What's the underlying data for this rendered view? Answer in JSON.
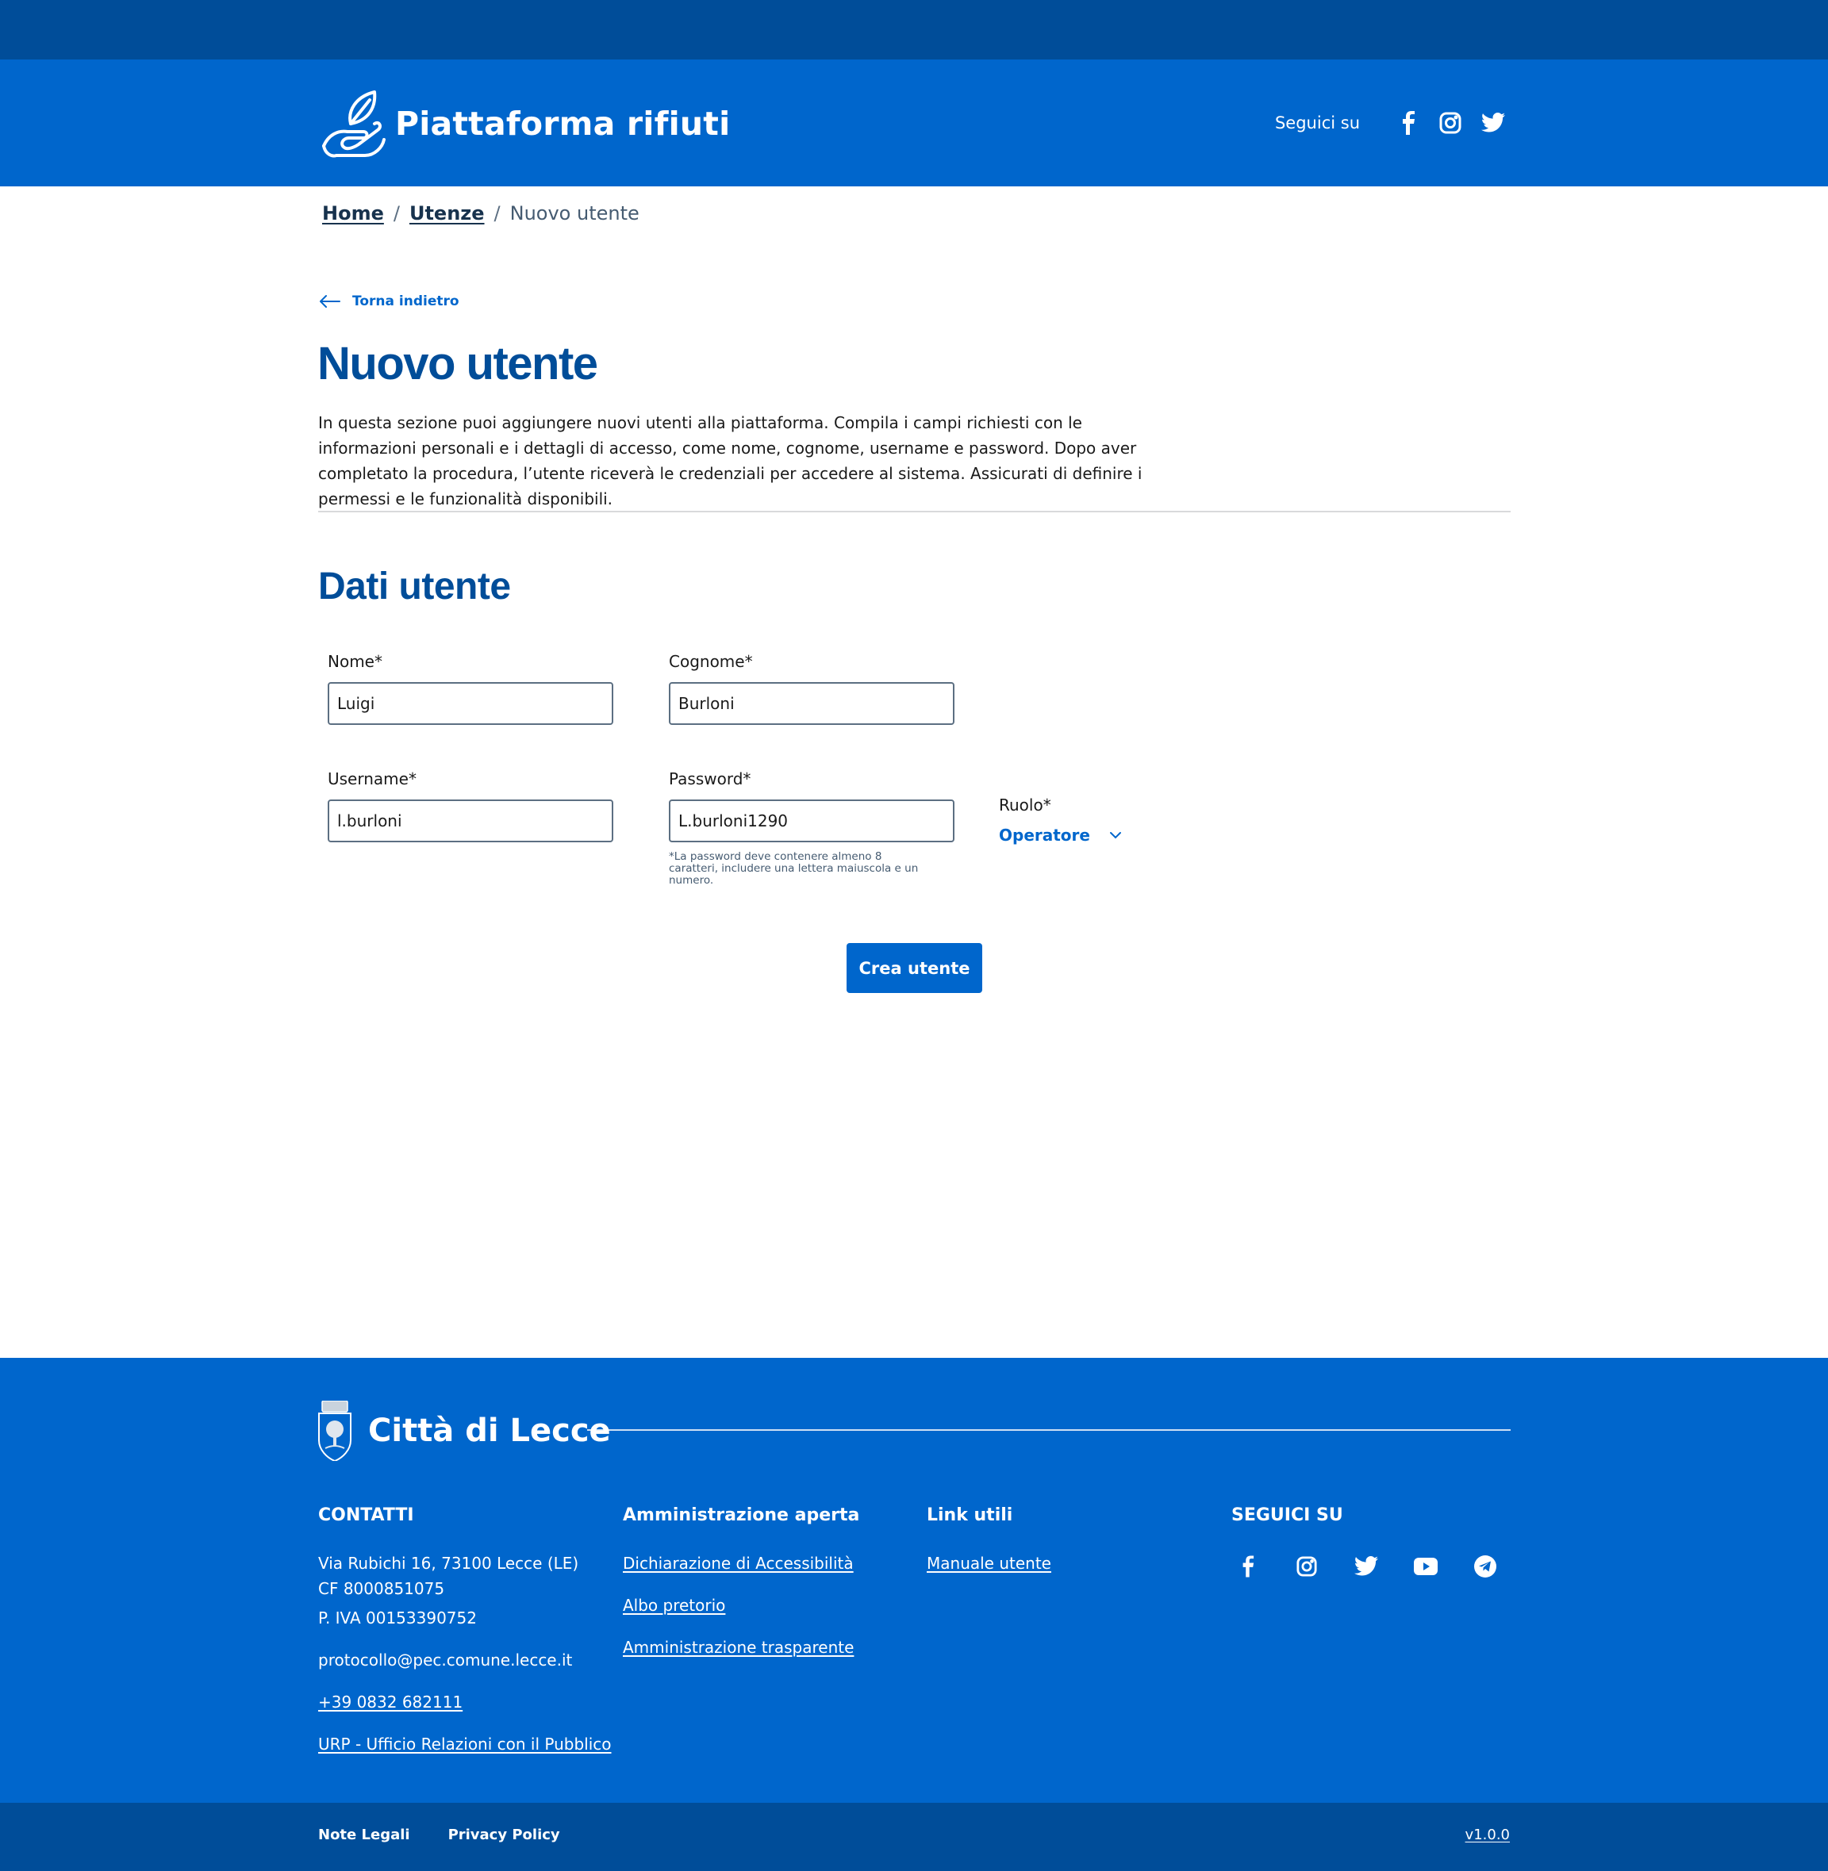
{
  "header": {
    "title": "Piattaforma rifiuti",
    "follow_label": "Seguici su",
    "social": [
      "facebook-icon",
      "instagram-icon",
      "twitter-icon"
    ]
  },
  "breadcrumb": {
    "home": "Home",
    "users": "Utenze",
    "current": "Nuovo utente",
    "separator": "/"
  },
  "back_label": "Torna indietro",
  "page": {
    "title": "Nuovo utente",
    "intro": "In questa sezione puoi aggiungere nuovi utenti alla piattaforma. Compila i campi richiesti con le informazioni personali e i dettagli di accesso, come nome, cognome, username e password. Dopo aver completato la procedura, l’utente riceverà le credenziali per accedere al sistema. Assicurati di definire i permessi e le funzionalità disponibili."
  },
  "form": {
    "section_title": "Dati utente",
    "nome": {
      "label": "Nome*",
      "value": "Luigi"
    },
    "cognome": {
      "label": "Cognome*",
      "value": "Burloni"
    },
    "username": {
      "label": "Username*",
      "value": "l.burloni"
    },
    "password": {
      "label": "Password*",
      "value": "L.burloni1290",
      "help": "*La password deve contenere almeno 8 caratteri, includere una lettera maiuscola e un numero."
    },
    "ruolo": {
      "label": "Ruolo*",
      "selected": "Operatore"
    },
    "submit_label": "Crea utente"
  },
  "footer": {
    "brand": "Città di Lecce",
    "contatti": {
      "title": "CONTATTI",
      "address": "Via Rubichi 16, 73100 Lecce (LE)",
      "cf": "CF 8000851075",
      "piva": "P. IVA 00153390752",
      "pec": "protocollo@pec.comune.lecce.it",
      "phone": "+39 0832 682111",
      "urp": "URP - Ufficio Relazioni con il Pubblico"
    },
    "amministrazione": {
      "title": "Amministrazione aperta",
      "links": [
        "Dichiarazione di Accessibilità",
        "Albo pretorio",
        "Amministrazione trasparente"
      ]
    },
    "link_utili": {
      "title": "Link utili",
      "links": [
        "Manuale utente"
      ]
    },
    "seguici": {
      "title": "SEGUICI SU",
      "social": [
        "facebook-icon",
        "instagram-icon",
        "twitter-icon",
        "youtube-icon",
        "telegram-icon"
      ]
    },
    "legal": [
      "Note Legali",
      "Privacy Policy"
    ],
    "version": "v1.0.0"
  },
  "colors": {
    "primary": "#0066cc",
    "primary_dark": "#004d99",
    "text": "#1a1a1a",
    "border": "#5c6f82"
  }
}
